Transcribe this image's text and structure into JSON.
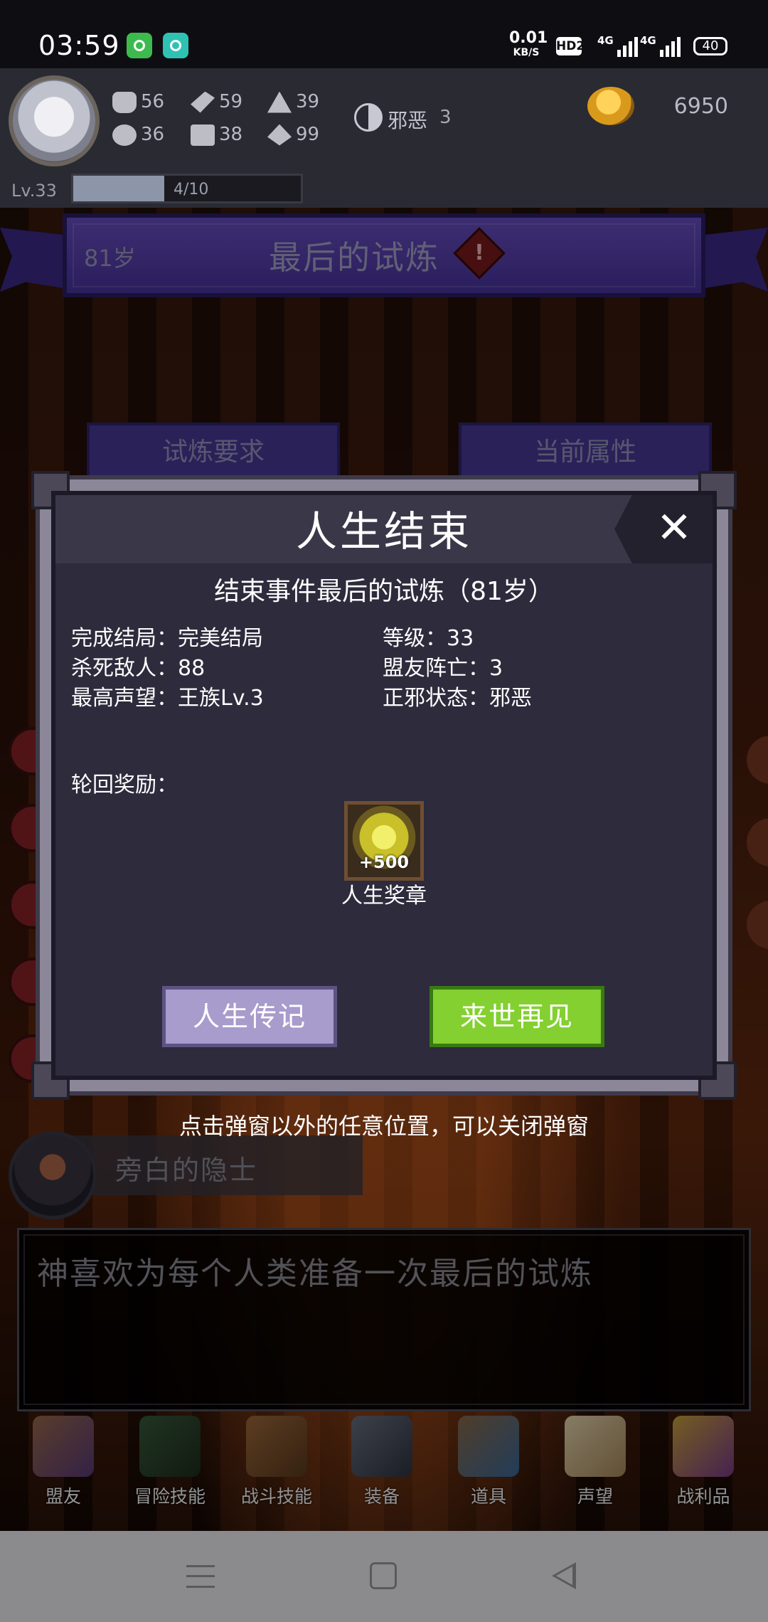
{
  "status_bar": {
    "time": "03:59",
    "net_speed": "0.01",
    "net_unit": "KB/S",
    "hd": "HD2",
    "signal_1": "4G",
    "signal_2": "4G",
    "battery": "40"
  },
  "hud": {
    "stats": {
      "strength": "56",
      "agility": "59",
      "magic": "39",
      "luck": "36",
      "defense": "38",
      "spirit": "99"
    },
    "karma_label": "邪恶",
    "karma_value": "3",
    "gold": "6950",
    "level": "Lv.33",
    "xp_text": "4/10",
    "xp_fraction": 0.4
  },
  "scene": {
    "age": "81岁",
    "title": "最后的试炼",
    "tab_requirements": "试炼要求",
    "tab_attributes": "当前属性"
  },
  "modal": {
    "title": "人生结束",
    "end_event": "结束事件最后的试炼（81岁）",
    "ending": "完成结局：完美结局",
    "level": "等级：33",
    "kills": "杀死敌人：88",
    "allies_lost": "盟友阵亡：3",
    "reputation": "最高声望：王族Lv.3",
    "alignment": "正邪状态：邪恶",
    "rewards_label": "轮回奖励：",
    "reward_amount": "+500",
    "reward_name": "人生奖章",
    "biography_button": "人生传记",
    "farewell_button": "来世再见"
  },
  "close_hint": "点击弹窗以外的任意位置，可以关闭弹窗",
  "narrator": {
    "name": "旁白的隐士"
  },
  "dialog": {
    "text": "神喜欢为每个人类准备一次最后的试炼"
  },
  "bottom_nav": [
    {
      "label": "盟友",
      "icon": "handshake-icon"
    },
    {
      "label": "冒险技能",
      "icon": "book-icon"
    },
    {
      "label": "战斗技能",
      "icon": "backpack-icon"
    },
    {
      "label": "装备",
      "icon": "crossed-swords-icon"
    },
    {
      "label": "道具",
      "icon": "bag-icon"
    },
    {
      "label": "声望",
      "icon": "scroll-icon"
    },
    {
      "label": "战利品",
      "icon": "treasure-chest-icon"
    }
  ],
  "colors": {
    "accent_purple": "#5a40b0",
    "button_green": "#84d030",
    "button_lavender": "#a79ccc",
    "modal_bg": "#2d2b3c"
  }
}
